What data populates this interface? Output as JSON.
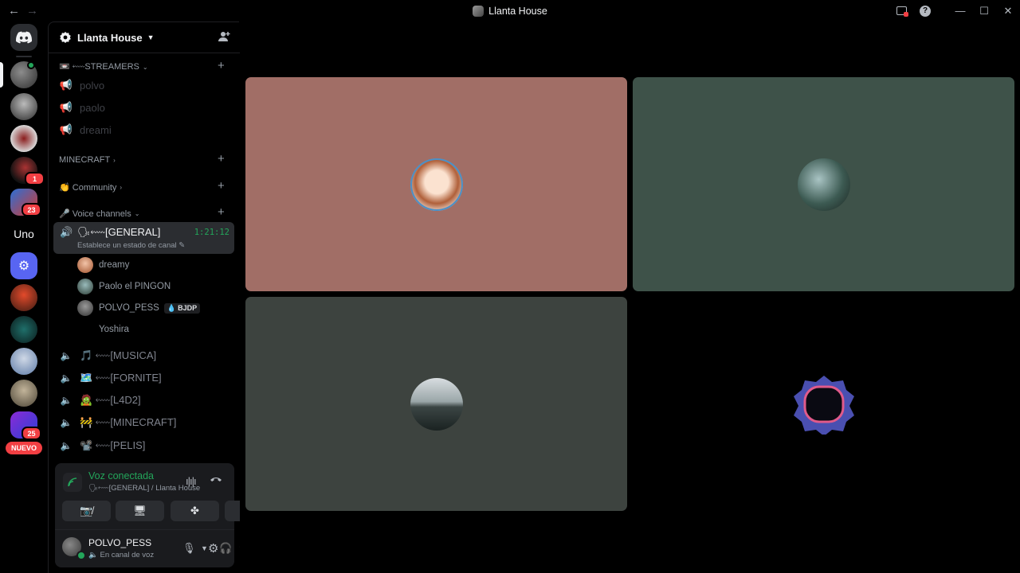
{
  "window": {
    "title": "Llanta House",
    "back_arrow": "←",
    "forward_arrow": "→",
    "minimize": "—",
    "maximize": "☐",
    "close": "✕"
  },
  "rail": {
    "uno_label": "Uno",
    "badges": [
      "1",
      "23",
      "25"
    ],
    "nuevo_label": "NUEVO"
  },
  "guild": {
    "name": "Llanta House",
    "icons": {
      "header": "server-badge-icon",
      "invite": "add-member-icon"
    }
  },
  "categories": [
    {
      "label": "📼 ⬳STREAMERS",
      "chevron": "⌄"
    },
    {
      "label": "MINECRAFT",
      "chevron": "›"
    },
    {
      "label": "👏 Community",
      "chevron": "›"
    },
    {
      "label": "🎤 Voice channels",
      "chevron": "⌄"
    }
  ],
  "streamer_channels": [
    "polvo",
    "paolo",
    "dreami"
  ],
  "active_voice": {
    "name": "🗣⬳[GENERAL]",
    "timer": "1:21:12",
    "status": "Establece un estado de canal",
    "users": [
      {
        "name": "dreamy"
      },
      {
        "name": "Paolo el PINGON"
      },
      {
        "name": "POLVO_PESS",
        "activity": "BJDP"
      },
      {
        "name": "Yoshira"
      }
    ]
  },
  "voice_channels": [
    "🎵 ⬳[MUSICA]",
    "🗺️ ⬳[FORNITE]",
    "🧟 ⬳[L4D2]",
    "🚧 ⬳[MINECRAFT]",
    "📽️ ⬳[PELIS]"
  ],
  "voice_panel": {
    "title": "Voz conectada",
    "subtitle": "🗣⬳[GENERAL] / Llanta House",
    "buttons": [
      "camera-off-icon",
      "screen-share-icon",
      "activities-icon",
      "soundboard-icon"
    ]
  },
  "user_panel": {
    "name": "POLVO_PESS",
    "status": "En canal de voz"
  },
  "tiles": [
    {
      "user": "dreamy",
      "bg": "#a16e66"
    },
    {
      "user": "Paolo el PINGON",
      "bg": "#3e5249"
    },
    {
      "user": "POLVO_PESS",
      "bg": "#3d433f"
    },
    {
      "user": "Yoshira",
      "bg": "#000000"
    }
  ],
  "colors": {
    "accent_green": "#23a55a",
    "danger_red": "#f23f43",
    "blurple": "#5865f2"
  }
}
